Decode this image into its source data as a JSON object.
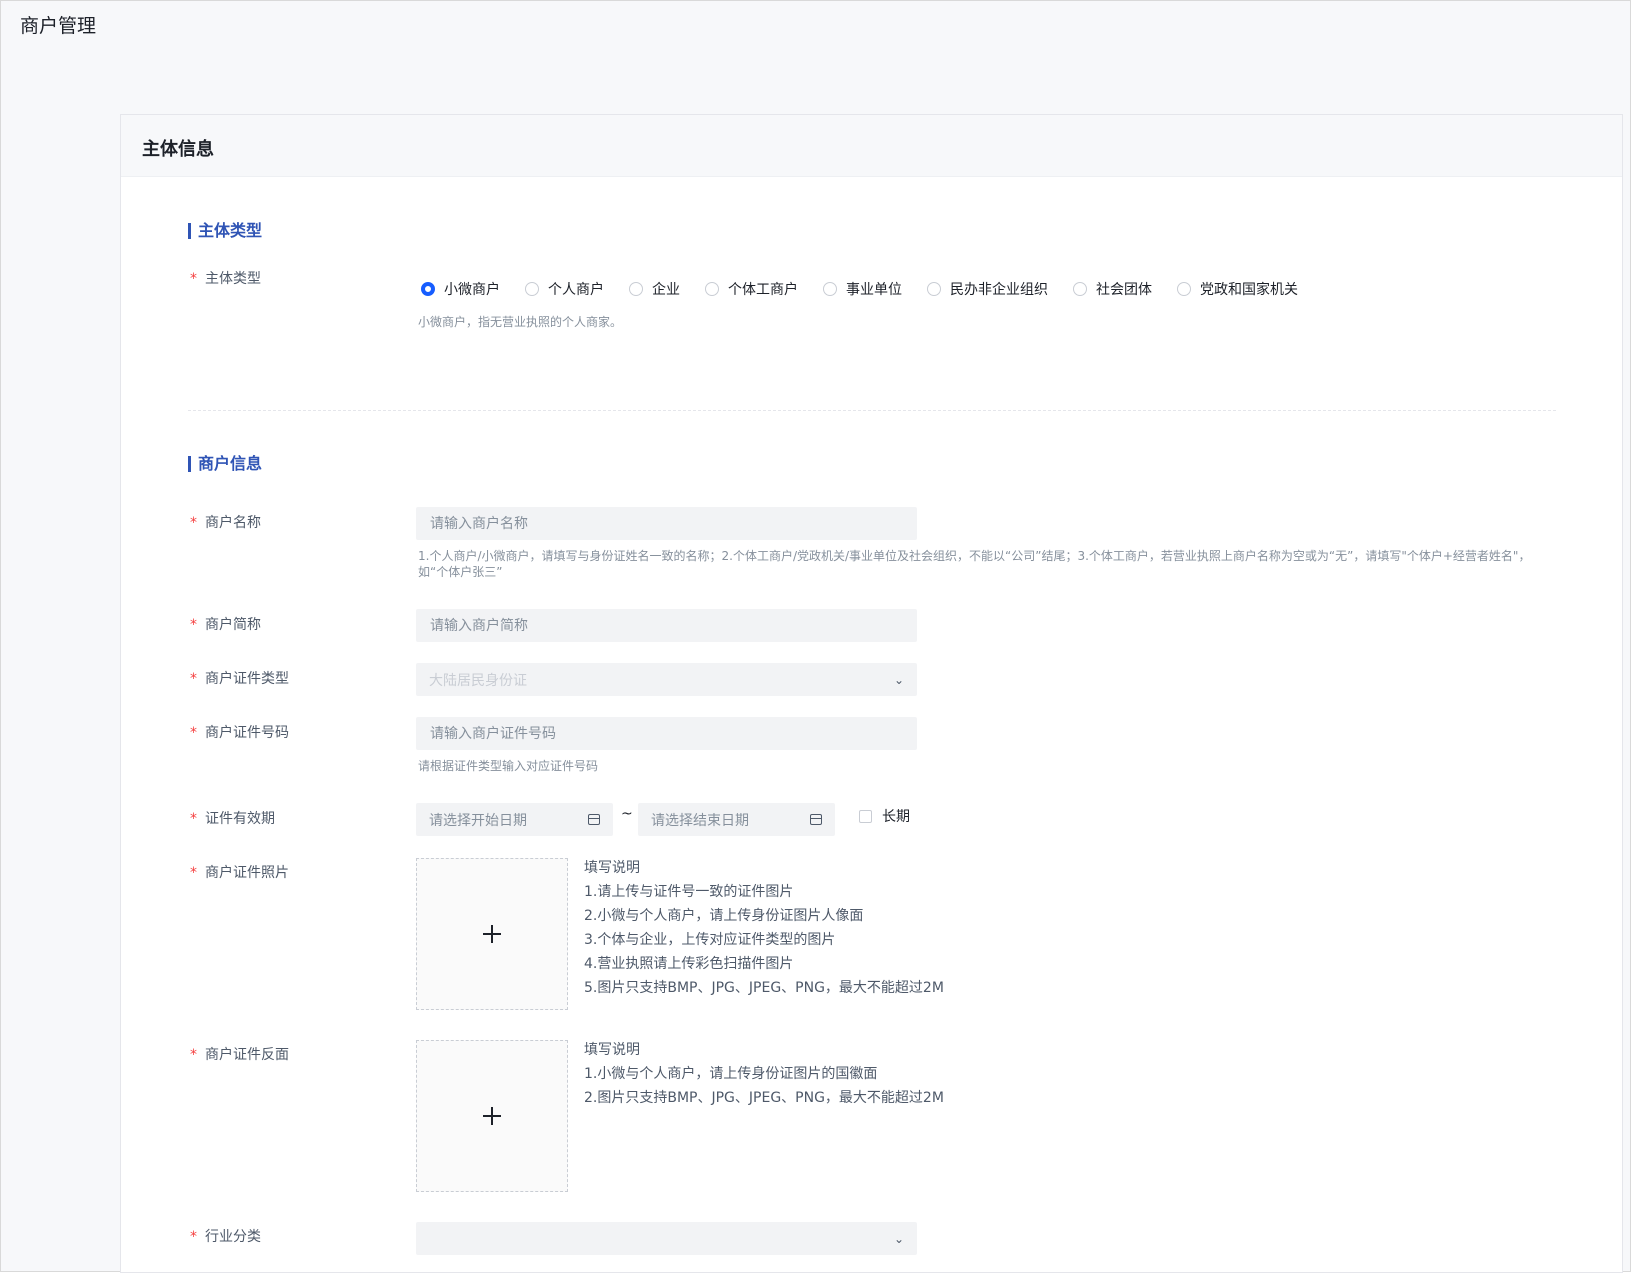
{
  "page": {
    "title": "商户管理"
  },
  "card": {
    "title": "主体信息"
  },
  "sections": {
    "entity": "主体类型",
    "merchant": "商户信息"
  },
  "entity_type": {
    "label": "主体类型",
    "options": [
      "小微商户",
      "个人商户",
      "企业",
      "个体工商户",
      "事业单位",
      "民办非企业组织",
      "社会团体",
      "党政和国家机关"
    ],
    "selected": "小微商户",
    "hint": "小微商户，指无营业执照的个人商家。"
  },
  "merchant_name": {
    "label": "商户名称",
    "placeholder": "请输入商户名称",
    "hint": "1.个人商户/小微商户，请填写与身份证姓名一致的名称；2.个体工商户/党政机关/事业单位及社会组织，不能以“公司”结尾；3.个体工商户，若营业执照上商户名称为空或为“无”，请填写\"个体户+经营者姓名\"，如“个体户张三”"
  },
  "merchant_short": {
    "label": "商户简称",
    "placeholder": "请输入商户简称"
  },
  "id_type": {
    "label": "商户证件类型",
    "value": "大陆居民身份证"
  },
  "id_number": {
    "label": "商户证件号码",
    "placeholder": "请输入商户证件号码",
    "hint": "请根据证件类型输入对应证件号码"
  },
  "validity": {
    "label": "证件有效期",
    "start_placeholder": "请选择开始日期",
    "end_placeholder": "请选择结束日期",
    "separator": "~",
    "long_term": "长期"
  },
  "id_photo": {
    "label": "商户证件照片",
    "notes": [
      "填写说明",
      "1.请上传与证件号一致的证件图片",
      "2.小微与个人商户，请上传身份证图片人像面",
      "3.个体与企业，上传对应证件类型的图片",
      "4.营业执照请上传彩色扫描件图片",
      "5.图片只支持BMP、JPG、JPEG、PNG，最大不能超过2M"
    ]
  },
  "id_back": {
    "label": "商户证件反面",
    "notes": [
      "填写说明",
      "1.小微与个人商户，请上传身份证图片的国徽面",
      "2.图片只支持BMP、JPG、JPEG、PNG，最大不能超过2M"
    ]
  },
  "industry": {
    "label": "行业分类",
    "value": ""
  },
  "colors": {
    "accent": "#165dff",
    "section": "#2f54b5",
    "required": "#f53f3f"
  }
}
